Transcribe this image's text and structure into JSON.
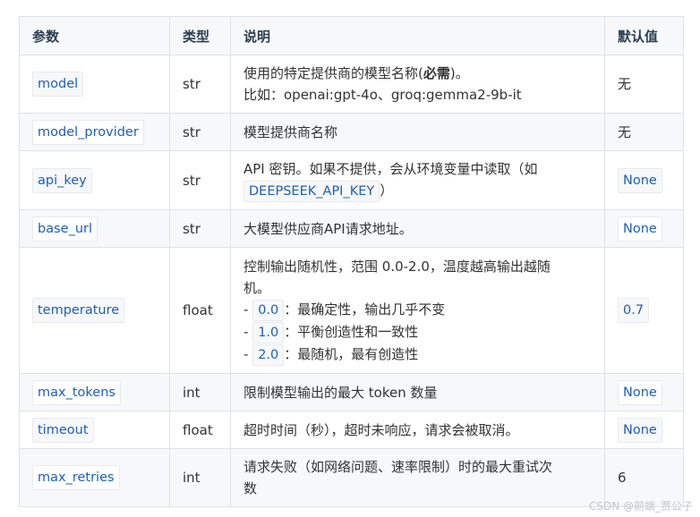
{
  "headers": {
    "param": "参数",
    "type": "类型",
    "desc": "说明",
    "default": "默认值"
  },
  "rows": [
    {
      "param": "model",
      "type": "str",
      "desc_line1": "使用的特定提供商的模型名称(",
      "desc_bold": "必需",
      "desc_line1_end": ")。",
      "desc_line2": "比如：openai:gpt-4o、groq:gemma2-9b-it",
      "default": "无"
    },
    {
      "param": "model_provider",
      "type": "str",
      "desc": "模型提供商名称",
      "default": "无"
    },
    {
      "param": "api_key",
      "type": "str",
      "desc_line1": "API 密钥。如果不提供，会从环境变量中读取（如",
      "desc_code": "DEEPSEEK_API_KEY",
      "desc_tail": "）",
      "default": "None"
    },
    {
      "param": "base_url",
      "type": "str",
      "desc": "大模型供应商API请求地址。",
      "default": "None"
    },
    {
      "param": "temperature",
      "type": "float",
      "desc_line1": "控制输出随机性，范围 0.0-2.0，温度越高输出越随",
      "desc_line2": "机。",
      "items": [
        {
          "dash": "-",
          "value": "0.0",
          "text": "：最确定性，输出几乎不变"
        },
        {
          "dash": "-",
          "value": "1.0",
          "text": "：平衡创造性和一致性"
        },
        {
          "dash": "-",
          "value": "2.0",
          "text": "：最随机，最有创造性"
        }
      ],
      "default": "0.7"
    },
    {
      "param": "max_tokens",
      "type": "int",
      "desc": "限制模型输出的最大 token 数量",
      "default": "None"
    },
    {
      "param": "timeout",
      "type": "float",
      "desc": "超时时间（秒），超时未响应，请求会被取消。",
      "default": "None"
    },
    {
      "param": "max_retries",
      "type": "int",
      "desc_line1": "请求失败（如网络问题、速率限制）时的最大重试次",
      "desc_line2": "数",
      "default": "6"
    }
  ],
  "watermark": "CSDN @前端_贾公子"
}
